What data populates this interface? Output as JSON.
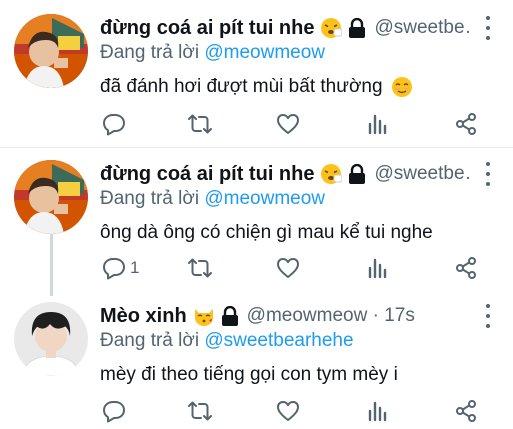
{
  "tweets": [
    {
      "name": "đừng coá ai pít tui nhe",
      "handle": "@sweetbe…",
      "replying_prefix": "Đang trả lời",
      "replying_to": "@meowmeow",
      "text": "đã đánh hơi đượt mùi bất thường",
      "reply_count": ""
    },
    {
      "name": "đừng coá ai pít tui nhe",
      "handle": "@sweetbe…",
      "replying_prefix": "Đang trả lời",
      "replying_to": "@meowmeow",
      "text": "ông dà ông có chiện gì mau kể tui nghe",
      "reply_count": "1"
    },
    {
      "name": "Mèo xinh",
      "handle": "@meowmeow · 17s",
      "replying_prefix": "Đang trả lời",
      "replying_to": "@sweetbearhehe",
      "text": "mèy đi theo tiếng gọi con tym mèy i",
      "reply_count": ""
    }
  ],
  "icons": {
    "reply": "reply-icon",
    "retweet": "retweet-icon",
    "like": "heart-icon",
    "views": "bar-chart-icon",
    "share": "share-icon",
    "more": "more-dots-icon",
    "lock": "lock-icon"
  },
  "colors": {
    "accent": "#1d9bf0",
    "secondary_text": "#536471",
    "primary_text": "#0f1419",
    "thread_line": "#cfd9de"
  }
}
